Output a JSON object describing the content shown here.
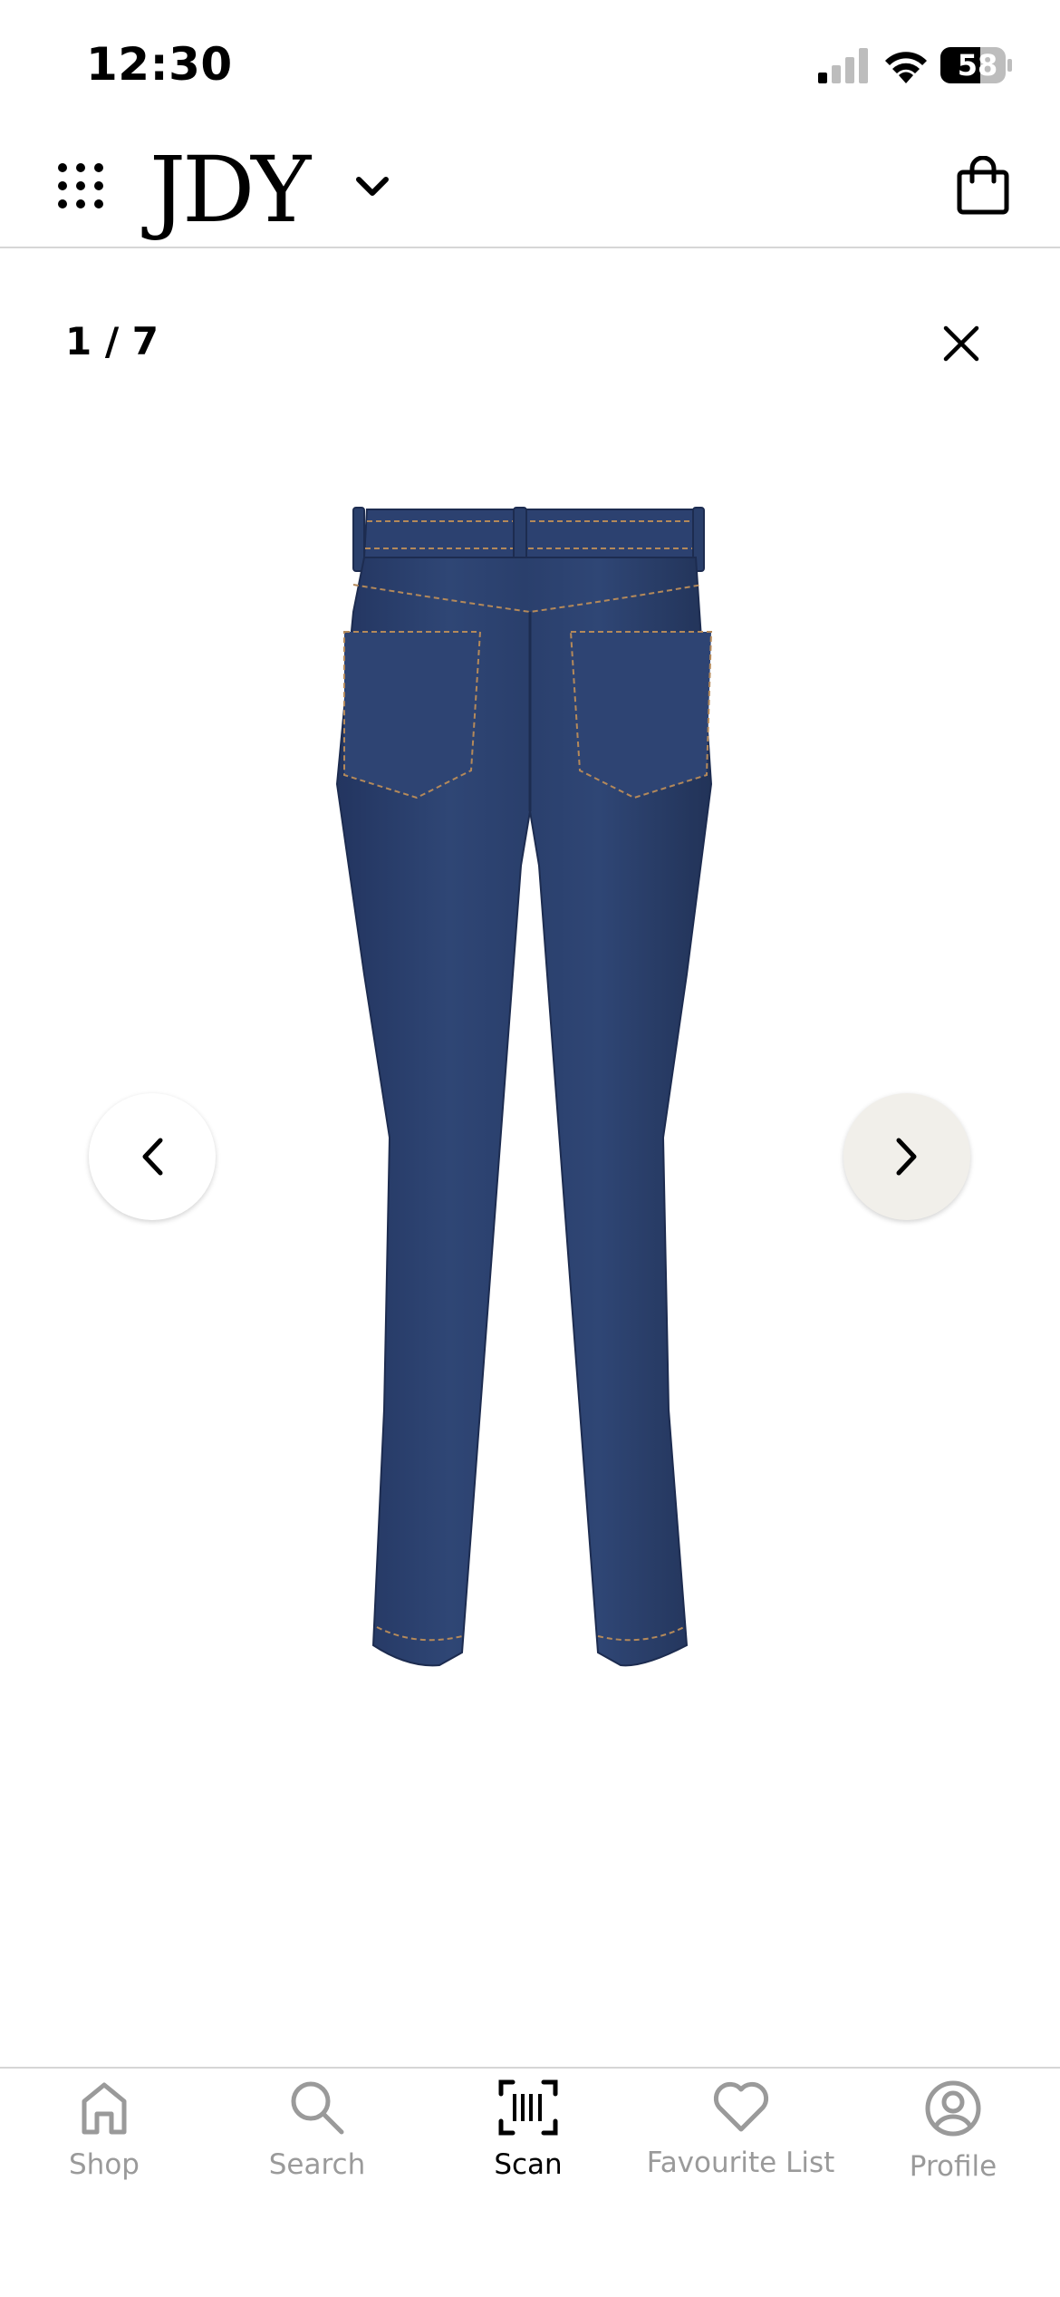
{
  "status_bar": {
    "time": "12:30",
    "battery": "58"
  },
  "header": {
    "brand": "JDY"
  },
  "gallery": {
    "counter": "1 / 7"
  },
  "tabs": [
    {
      "label": "Shop",
      "icon": "home-icon",
      "active": false
    },
    {
      "label": "Search",
      "icon": "search-icon",
      "active": false
    },
    {
      "label": "Scan",
      "icon": "barcode-scan-icon",
      "active": true
    },
    {
      "label": "Favourite List",
      "icon": "heart-icon",
      "active": false
    },
    {
      "label": "Profile",
      "icon": "user-circle-icon",
      "active": false
    }
  ],
  "colors": {
    "denim": "#2b3f6e",
    "nav_next_bg": "#f1efea",
    "inactive_tab": "#9a9a9a",
    "divider": "#d6d6d6"
  }
}
